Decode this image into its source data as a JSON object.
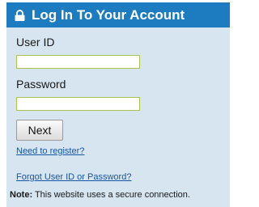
{
  "login": {
    "title": "Log In To Your Account",
    "lock_icon": "lock-icon",
    "user_id": {
      "label": "User ID",
      "value": "",
      "placeholder": ""
    },
    "password": {
      "label": "Password",
      "value": "",
      "placeholder": ""
    },
    "next_label": "Next",
    "register_link": "Need to register?",
    "forgot_link": "Forgot User ID or Password?",
    "note_label": "Note:",
    "note_text": " This website uses a secure connection."
  },
  "colors": {
    "header_bg": "#1d7cbf",
    "panel_bg": "#d6e5ef",
    "input_border": "#a9c44d",
    "link": "#1456a6"
  }
}
